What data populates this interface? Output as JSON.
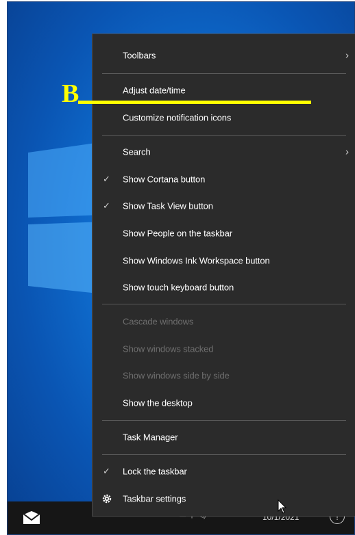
{
  "annotation": {
    "letter": "B"
  },
  "menu": {
    "items": [
      {
        "label": "Toolbars",
        "submenu": true
      },
      {
        "label": "Adjust date/time"
      },
      {
        "label": "Customize notification icons"
      },
      {
        "label": "Search",
        "submenu": true
      },
      {
        "label": "Show Cortana button",
        "checked": true
      },
      {
        "label": "Show Task View button",
        "checked": true
      },
      {
        "label": "Show People on the taskbar"
      },
      {
        "label": "Show Windows Ink Workspace button"
      },
      {
        "label": "Show touch keyboard button"
      },
      {
        "label": "Cascade windows",
        "disabled": true
      },
      {
        "label": "Show windows stacked",
        "disabled": true
      },
      {
        "label": "Show windows side by side",
        "disabled": true
      },
      {
        "label": "Show the desktop"
      },
      {
        "label": "Task Manager"
      },
      {
        "label": "Lock the taskbar",
        "checked": true
      },
      {
        "label": "Taskbar settings",
        "icon": "gear-icon"
      }
    ]
  },
  "taskbar": {
    "clock": "10/1/2021",
    "tray_icons": "▭  ⚲  ◁)"
  },
  "icons": {
    "submenu": "chevron-right-icon",
    "check": "checkmark-icon",
    "settings": "gear-icon",
    "mail": "mail-icon",
    "notifications": "notification-center-icon"
  },
  "colors": {
    "menu_bg": "#2b2b2b",
    "menu_text": "#ffffff",
    "disabled_text": "#6e6e6e",
    "annotation": "#ffff00",
    "desktop": "#0f6fd1",
    "taskbar": "#161616"
  }
}
